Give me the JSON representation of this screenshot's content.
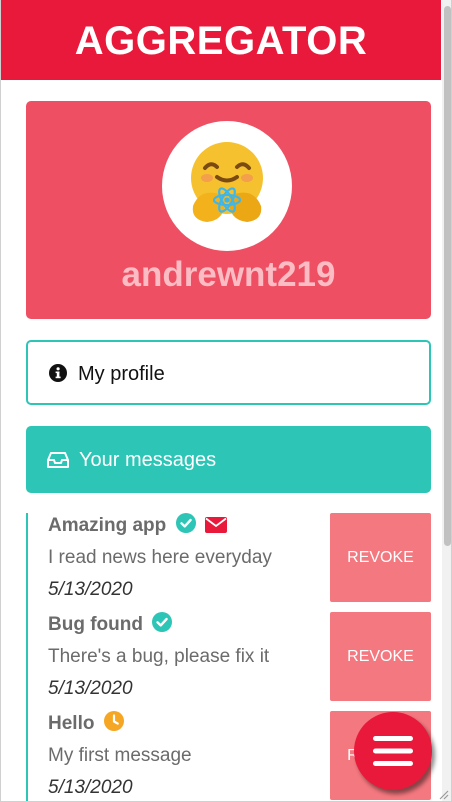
{
  "header": {
    "title": "AGGREGATOR"
  },
  "profile": {
    "username": "andrewnt219",
    "avatar_icon": "hugging-face-emoji-icon"
  },
  "nav": {
    "my_profile_label": "My profile",
    "messages_label": "Your messages"
  },
  "messages": [
    {
      "title": "Amazing app",
      "body": "I read news here everyday",
      "date": "5/13/2020",
      "revoke_label": "REVOKE",
      "status_icons": [
        "check-circle-icon",
        "envelope-icon"
      ]
    },
    {
      "title": "Bug found",
      "body": "There's a bug, please fix it",
      "date": "5/13/2020",
      "revoke_label": "REVOKE",
      "status_icons": [
        "check-circle-icon"
      ]
    },
    {
      "title": "Hello",
      "body": "My first message",
      "date": "5/13/2020",
      "revoke_label": "REVOKE",
      "status_icons": [
        "clock-icon"
      ]
    }
  ],
  "fab": {
    "icon": "hamburger-menu-icon"
  },
  "colors": {
    "header": "#e8193a",
    "profile_card": "#ef4f62",
    "accent_teal": "#2cc5b6",
    "revoke": "#f4787f",
    "pending": "#f5a623",
    "verified": "#2cc5b6",
    "envelope": "#e8193a"
  }
}
